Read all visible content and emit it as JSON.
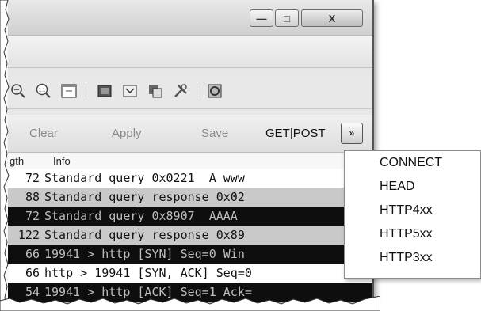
{
  "toolbar": {
    "icons": [
      "zoom-out-icon",
      "zoom-normal-icon",
      "resize-columns-icon",
      "capture-filters-icon",
      "display-filters-icon",
      "coloring-rules-icon",
      "preferences-icon",
      "help-icon"
    ]
  },
  "filter_toolbar": {
    "clear": "Clear",
    "apply": "Apply",
    "save": "Save",
    "getpost": "GET|POST",
    "more": "»"
  },
  "columns": {
    "length": "gth",
    "info": "Info"
  },
  "packets": [
    {
      "length": "72",
      "info": "Standard query 0x0221  A www",
      "style": "white"
    },
    {
      "length": "88",
      "info": "Standard query response 0x02",
      "style": "gray"
    },
    {
      "length": "72",
      "info": "Standard query 0x8907  AAAA",
      "style": "black"
    },
    {
      "length": "122",
      "info": "Standard query response 0x89",
      "style": "gray"
    },
    {
      "length": "66",
      "info": "19941 > http [SYN] Seq=0 Win",
      "style": "black"
    },
    {
      "length": "66",
      "info": "http > 19941 [SYN, ACK] Seq=0",
      "style": "white"
    },
    {
      "length": "54",
      "info": "19941 > http [ACK] Seq=1 Ack=",
      "style": "black"
    }
  ],
  "dropdown": {
    "items": [
      "CONNECT",
      "HEAD",
      "HTTP4xx",
      "HTTP5xx",
      "HTTP3xx"
    ]
  },
  "window_controls": {
    "minimize": "—",
    "maximize": "□",
    "close": "X"
  }
}
